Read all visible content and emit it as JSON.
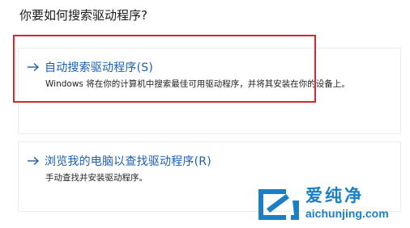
{
  "dialog": {
    "question": "你要如何搜索驱动程序?"
  },
  "options": [
    {
      "title": "自动搜索驱动程序(S)",
      "description": "Windows 将在你的计算机中搜索最佳可用驱动程序，并将其安装在你的设备上。",
      "icon": "arrow-right-icon"
    },
    {
      "title": "浏览我的电脑以查找驱动程序(R)",
      "description": "手动查找并安装驱动程序。",
      "icon": "arrow-right-icon"
    }
  ],
  "highlight": {
    "color": "#d9262c"
  },
  "watermark": {
    "brand": "爱纯净",
    "url": "aichunjing.com",
    "color": "#1a7fc4"
  },
  "colors": {
    "link": "#1a5fb4",
    "card_border": "#ececec"
  }
}
